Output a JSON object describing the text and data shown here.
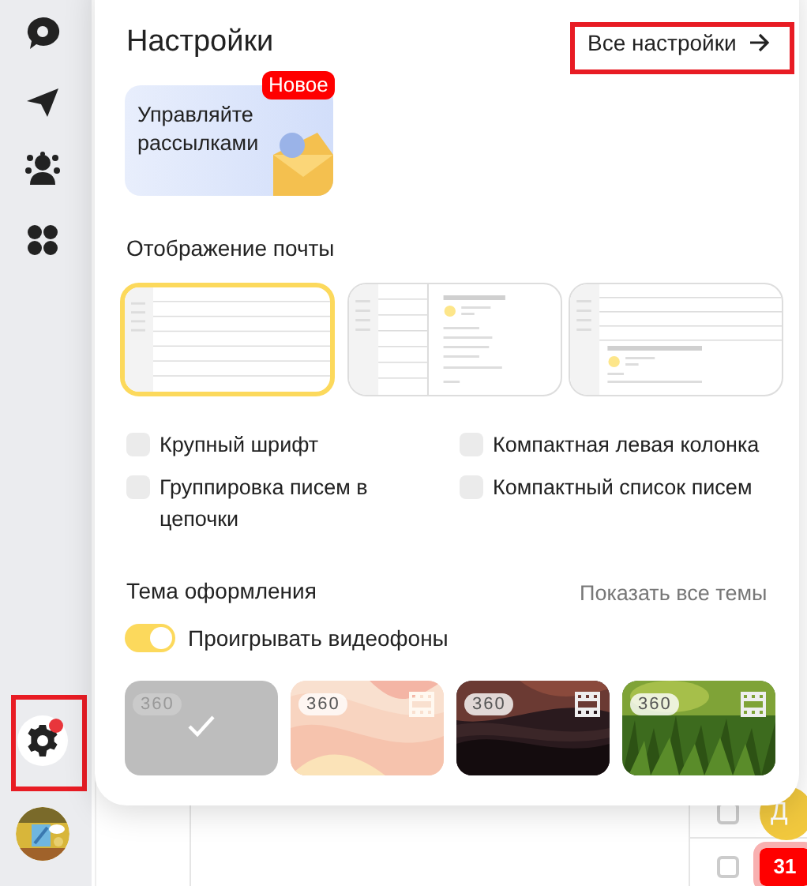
{
  "sidebar": {
    "settings": {
      "selected": true,
      "notification": true
    }
  },
  "settings_panel": {
    "title": "Настройки",
    "all_settings_link": "Все настройки",
    "promo": {
      "badge": "Новое",
      "text": "Управляйте рассылками"
    },
    "mail_display": {
      "heading": "Отображение почты",
      "layouts": [
        {
          "kind": "list",
          "selected": true
        },
        {
          "kind": "split",
          "selected": false
        },
        {
          "kind": "bottom",
          "selected": false
        }
      ]
    },
    "options": [
      {
        "label": "Крупный шрифт",
        "checked": false
      },
      {
        "label": "Компактная левая колонка",
        "checked": false
      },
      {
        "label": "Группировка писем в цепочки",
        "checked": false
      },
      {
        "label": "Компактный список писем",
        "checked": false
      }
    ],
    "theme": {
      "heading": "Тема оформления",
      "show_all": "Показать все темы",
      "video_toggle": {
        "label": "Проигрывать видеофоны",
        "on": true
      },
      "themes": [
        {
          "kind": "plain",
          "badge": "360",
          "video": false,
          "selected": true
        },
        {
          "kind": "peach",
          "badge": "360",
          "video": true,
          "selected": false
        },
        {
          "kind": "dark",
          "badge": "360",
          "video": true,
          "selected": false
        },
        {
          "kind": "grass",
          "badge": "360",
          "video": true,
          "selected": false
        }
      ]
    }
  },
  "mail_list": {
    "rows": [
      {
        "kind": "avatar",
        "text": "Д",
        "checked": false
      },
      {
        "kind": "calendar",
        "text": "31",
        "checked": false
      }
    ]
  }
}
